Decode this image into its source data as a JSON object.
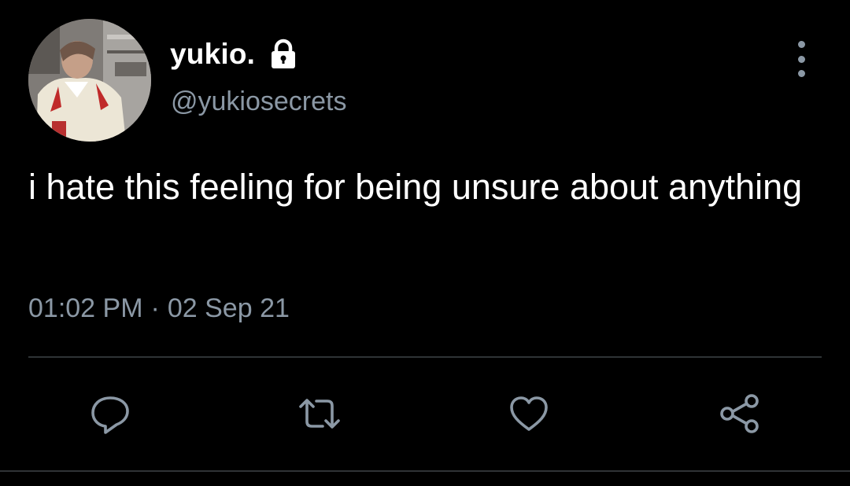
{
  "user": {
    "display_name": "yukio.",
    "handle": "@yukiosecrets",
    "protected": true
  },
  "tweet": {
    "text": "i hate this feeling for being unsure about anything",
    "time": "01:02 PM",
    "separator": "·",
    "date": "02 Sep 21"
  },
  "icons": {
    "lock": "lock-icon",
    "more": "more-vertical-icon",
    "reply": "reply-icon",
    "retweet": "retweet-icon",
    "like": "heart-icon",
    "share": "share-icon"
  },
  "colors": {
    "background": "#000000",
    "primary_text": "#ffffff",
    "secondary_text": "#8b98a5",
    "divider": "#2f3336"
  }
}
